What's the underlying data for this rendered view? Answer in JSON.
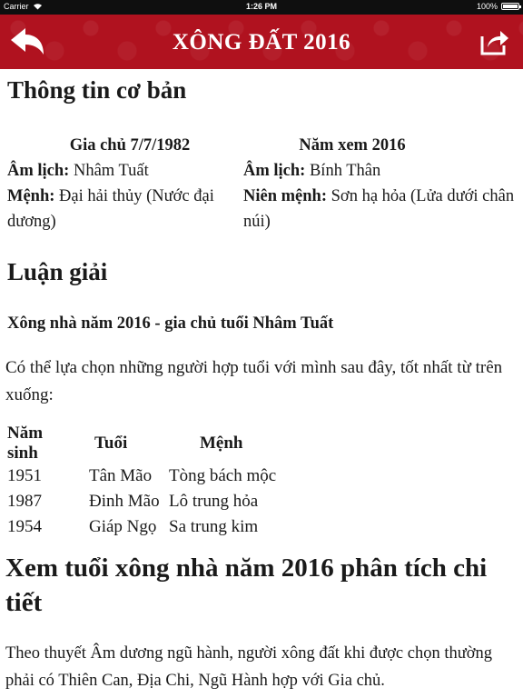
{
  "status_bar": {
    "carrier": "Carrier",
    "time": "1:26 PM",
    "battery": "100%"
  },
  "nav": {
    "title": "XÔNG ĐẤT 2016",
    "back_icon": "back-arrow-icon",
    "share_icon": "share-icon"
  },
  "basic_info": {
    "heading": "Thông tin cơ bản",
    "owner": {
      "title": "Gia chủ 7/7/1982",
      "lunar_label": "Âm lịch:",
      "lunar_value": "Nhâm Tuất",
      "fate_label": "Mệnh:",
      "fate_value": "Đại hải thủy (Nước đại dương)"
    },
    "year": {
      "title": "Năm xem 2016",
      "lunar_label": "Âm lịch:",
      "lunar_value": "Bính Thân",
      "fate_label": "Niên mệnh:",
      "fate_value": "Sơn hạ hỏa (Lửa dưới chân núi)"
    }
  },
  "analysis": {
    "heading": "Luận giải",
    "subheading": "Xông nhà năm 2016 - gia chủ tuổi Nhâm Tuất",
    "intro": "Có thể lựa chọn những người hợp tuổi với mình sau đây, tốt nhất từ trên xuống:",
    "table": {
      "headers": [
        "Năm sinh",
        "Tuổi",
        "Mệnh"
      ],
      "rows": [
        [
          "1951",
          "Tân Mão",
          "Tòng bách mộc"
        ],
        [
          "1987",
          "Đinh Mão",
          "Lô trung hỏa"
        ],
        [
          "1954",
          "Giáp Ngọ",
          "Sa trung kim"
        ]
      ]
    }
  },
  "detail": {
    "heading": "Xem tuổi xông nhà năm 2016 phân tích chi tiết",
    "paragraph": "Theo thuyết Âm dương ngũ hành, người xông đất khi được chọn thường phải có Thiên Can, Địa Chi, Ngũ Hành hợp với Gia chủ."
  }
}
